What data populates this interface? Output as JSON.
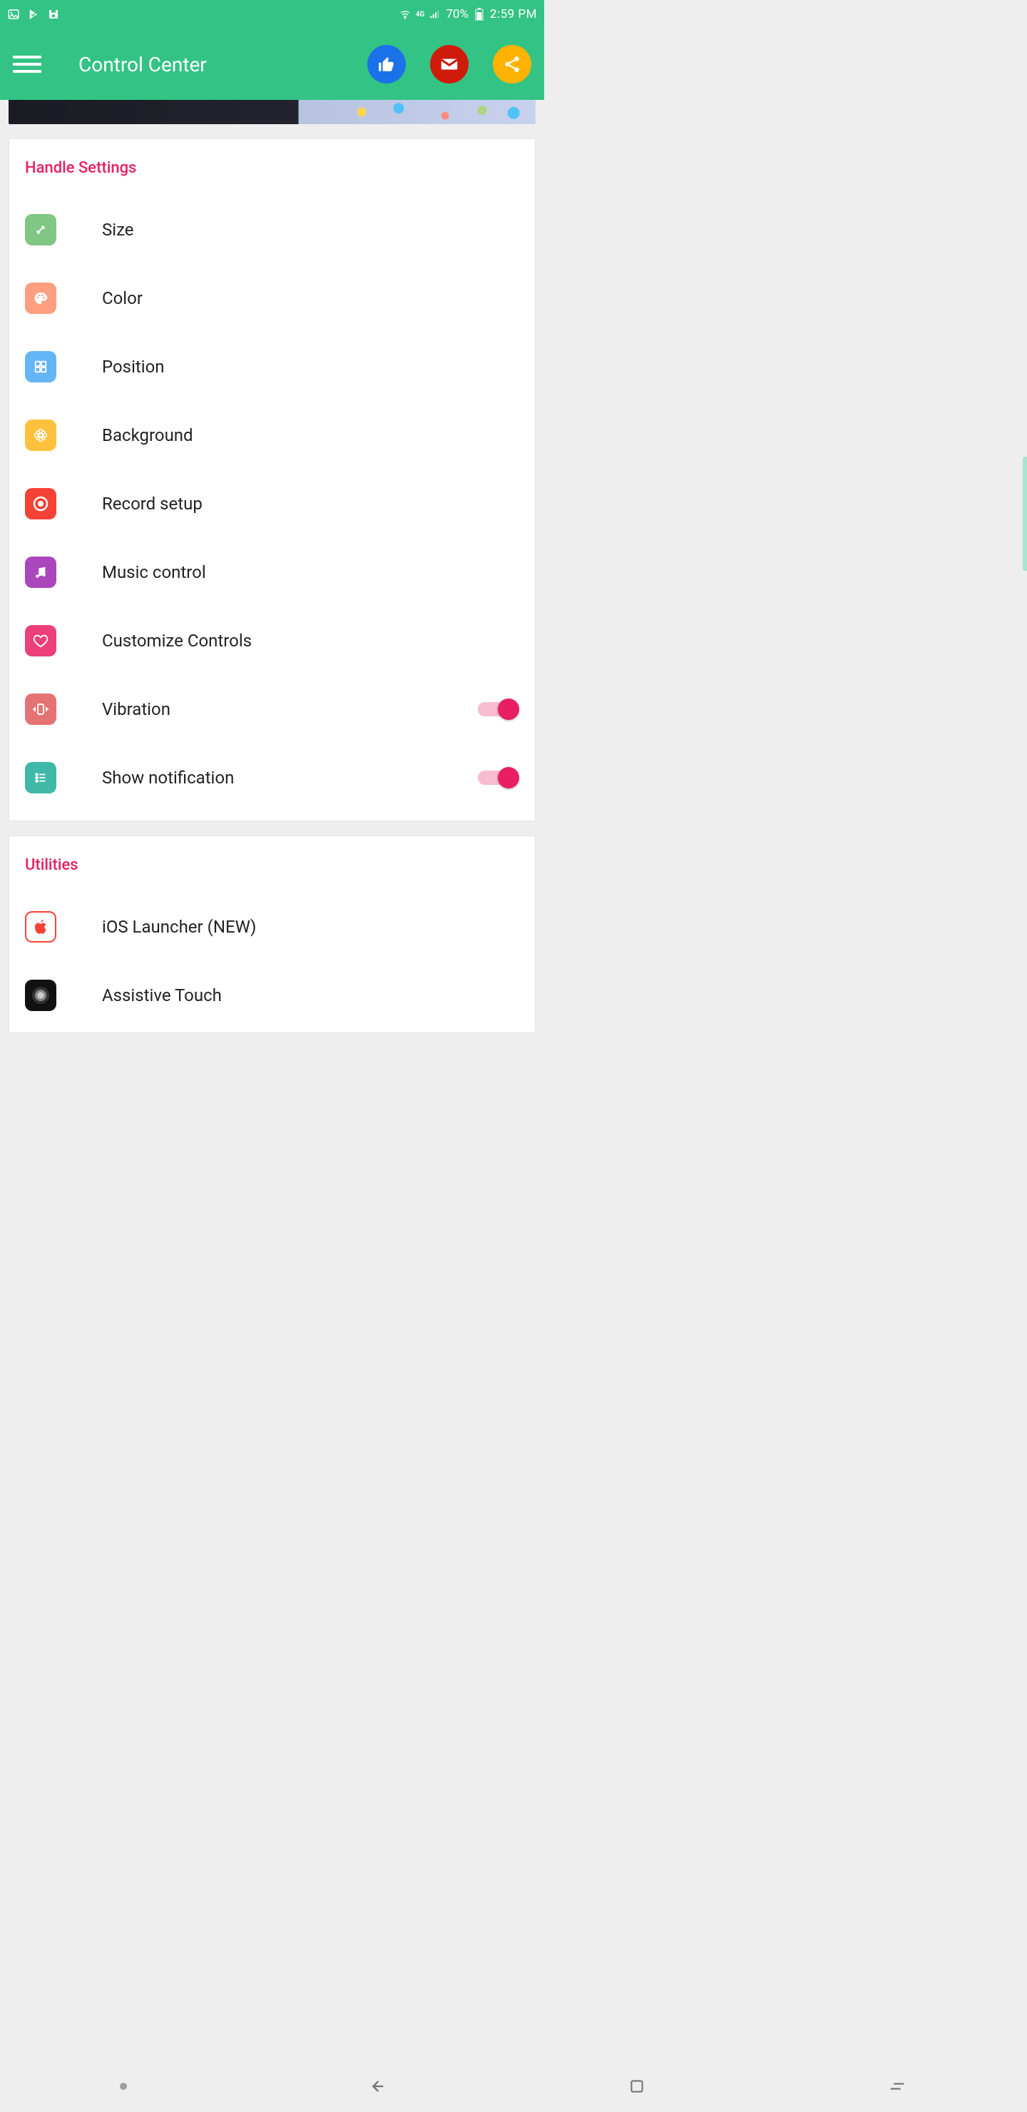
{
  "status": {
    "battery": "70%",
    "time": "2:59 PM",
    "network": "4G"
  },
  "header": {
    "title": "Control Center"
  },
  "sections": [
    {
      "title": "Handle Settings",
      "items": [
        {
          "label": "Size",
          "icon": "resize-icon",
          "icon_bg": "ic-green",
          "toggle": null
        },
        {
          "label": "Color",
          "icon": "palette-icon",
          "icon_bg": "ic-orange",
          "toggle": null
        },
        {
          "label": "Position",
          "icon": "grid-icon",
          "icon_bg": "ic-blue",
          "toggle": null
        },
        {
          "label": "Background",
          "icon": "flower-icon",
          "icon_bg": "ic-amber",
          "toggle": null
        },
        {
          "label": "Record setup",
          "icon": "record-icon",
          "icon_bg": "ic-red",
          "toggle": null
        },
        {
          "label": "Music control",
          "icon": "music-icon",
          "icon_bg": "ic-purple",
          "toggle": null
        },
        {
          "label": "Customize Controls",
          "icon": "heart-icon",
          "icon_bg": "ic-pink",
          "toggle": null
        },
        {
          "label": "Vibration",
          "icon": "vibrate-icon",
          "icon_bg": "ic-salmon",
          "toggle": true
        },
        {
          "label": "Show notification",
          "icon": "list-icon",
          "icon_bg": "ic-teal",
          "toggle": true
        }
      ]
    },
    {
      "title": "Utilities",
      "items": [
        {
          "label": "iOS Launcher (NEW)",
          "icon": "apple-icon",
          "icon_bg": "ic-white",
          "toggle": null
        },
        {
          "label": "Assistive Touch",
          "icon": "assistive-icon",
          "icon_bg": "ic-black",
          "toggle": null
        }
      ]
    }
  ]
}
